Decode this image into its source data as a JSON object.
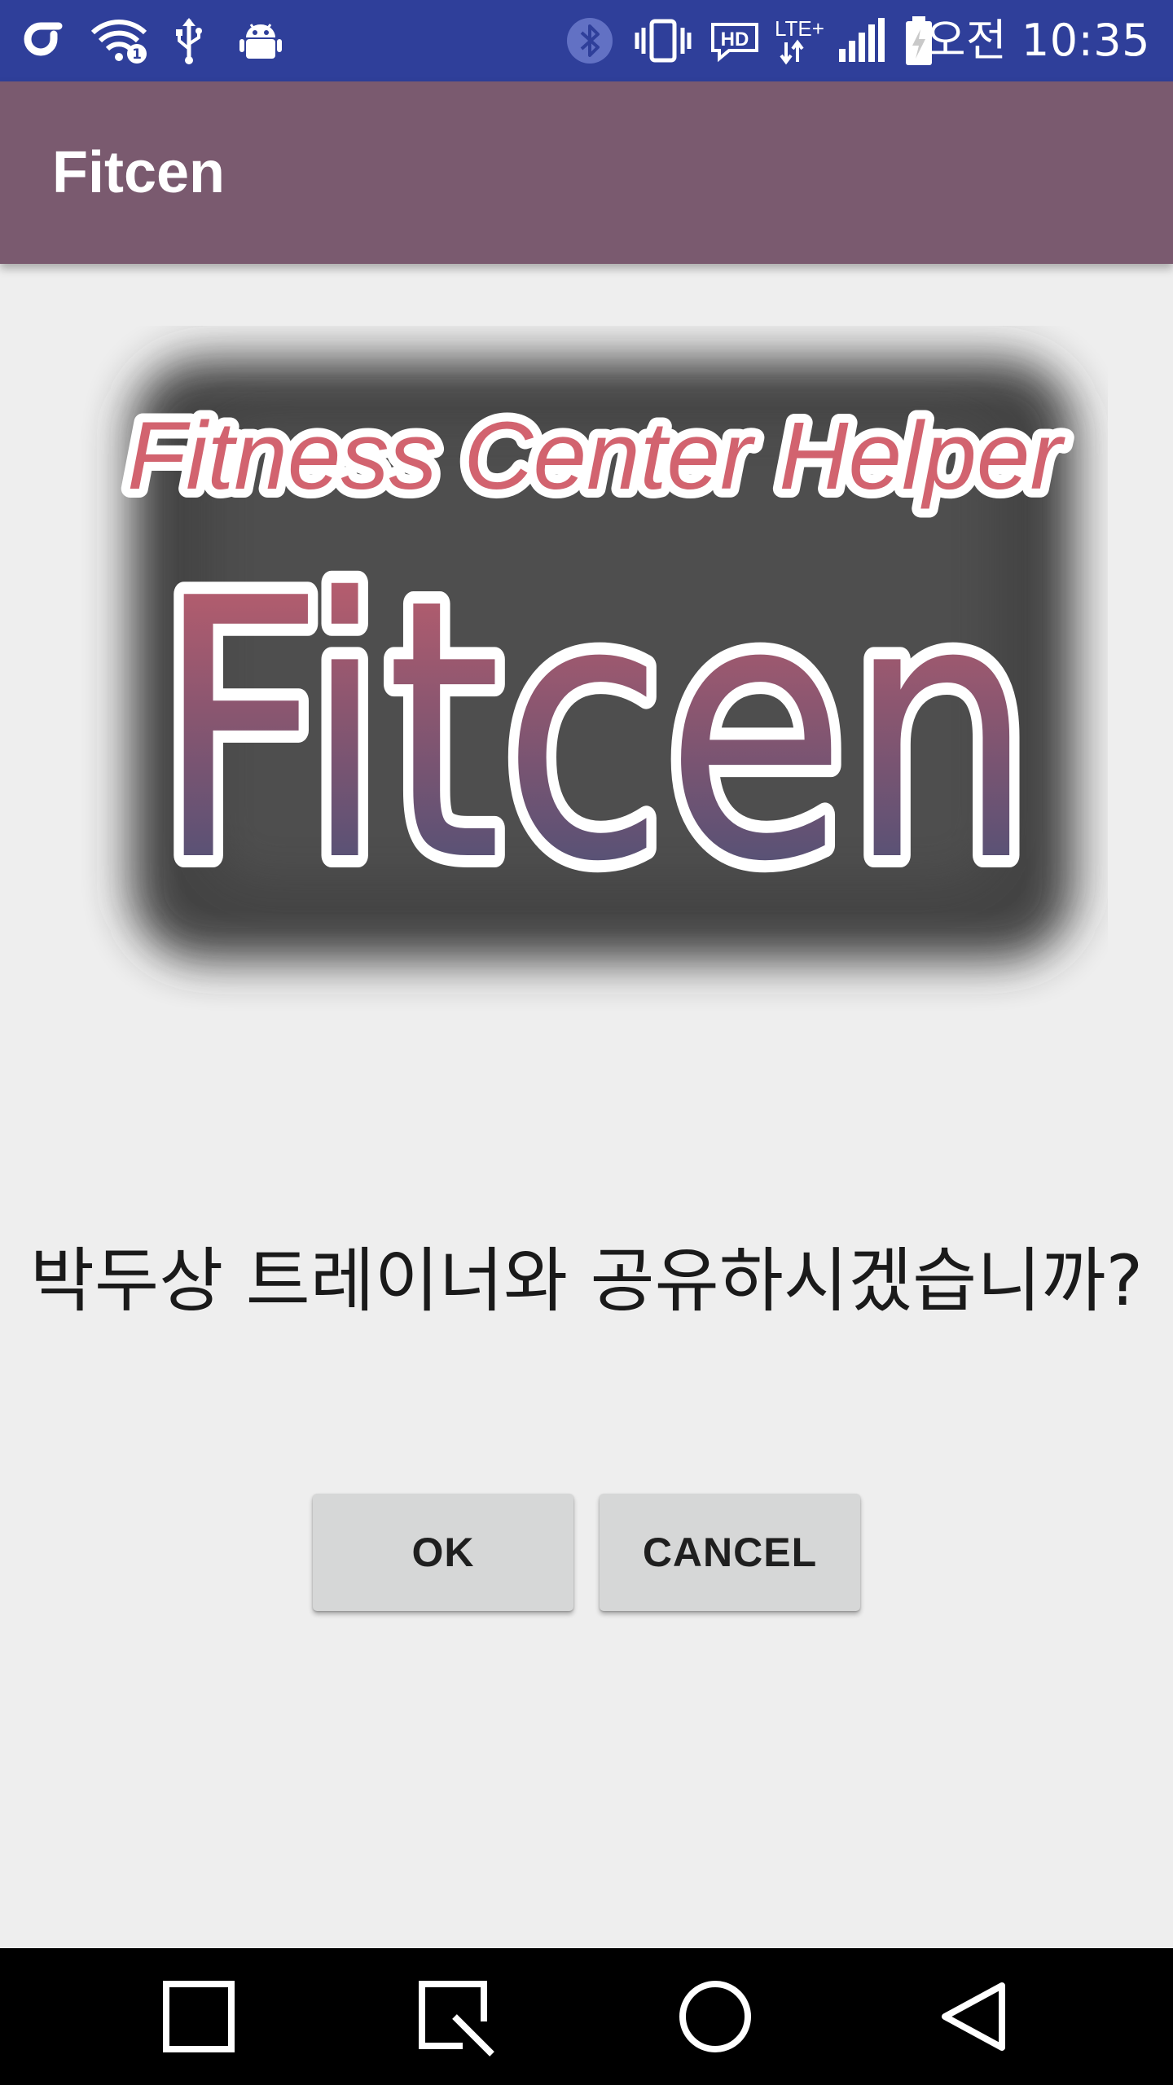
{
  "status_bar": {
    "time": "오전 10:35",
    "icons": [
      "carrier-logo-icon",
      "wifi-icon",
      "usb-icon",
      "android-debug-icon",
      "bluetooth-icon",
      "vibrate-icon",
      "hd-voice-icon",
      "lte-plus-icon",
      "signal-icon",
      "battery-charging-icon"
    ],
    "hd_label": "HD",
    "lte_label": "LTE+"
  },
  "app_bar": {
    "title": "Fitcen"
  },
  "logo": {
    "tagline": "Fitness Center Helper",
    "wordmark": "Fitcen",
    "colors": {
      "tagline": "#d2636f",
      "wordmark_top": "#c9606d",
      "wordmark_bottom": "#3f4f78"
    }
  },
  "dialog": {
    "question": "박두상 트레이너와 공유하시겠습니까?",
    "ok_label": "OK",
    "cancel_label": "CANCEL"
  },
  "nav_bar": {
    "buttons": [
      "recents-icon",
      "capture-icon",
      "home-icon",
      "back-icon"
    ]
  },
  "colors": {
    "status_bar": "#2f3f9a",
    "app_bar": "#7a5a6f",
    "background": "#eeeeee",
    "button": "#d6d7d7",
    "nav_bar": "#000000"
  }
}
